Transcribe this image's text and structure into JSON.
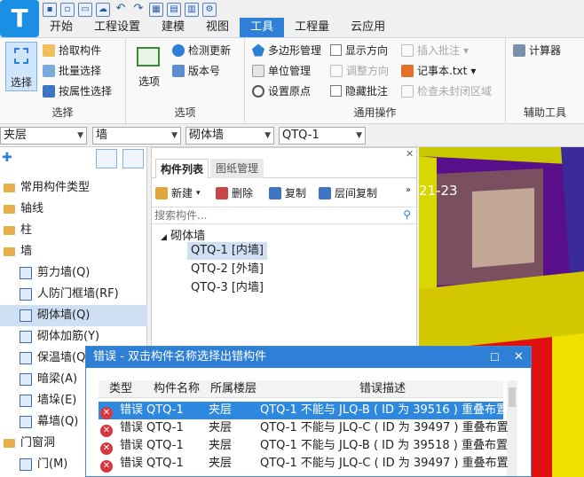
{
  "app": {
    "logo_letter": "T"
  },
  "menu": [
    "开始",
    "工程设置",
    "建模",
    "视图",
    "工具",
    "工程量",
    "云应用"
  ],
  "menu_active": "工具",
  "ribbon": {
    "select_group": {
      "select_button": "选择",
      "pick": "拾取构件",
      "batch": "批量选择",
      "by_attr": "按属性选择",
      "label": "选择"
    },
    "options_group": {
      "options_button": "选项",
      "check_update": "检测更新",
      "version": "版本号",
      "label": "选项"
    },
    "common_group": {
      "polygon": "多边形管理",
      "unit": "单位管理",
      "origin": "设置原点",
      "show_dir": "显示方向",
      "adjust_dir": "调整方向",
      "hide_note": "隐藏批注",
      "insert_note": "插入批注",
      "notepad": "记事本.txt",
      "check_open": "检查未封闭区域",
      "label": "通用操作"
    },
    "aux_group": {
      "calc": "计算器",
      "label": "辅助工具"
    }
  },
  "filters": {
    "floor": "夹层",
    "type": "墙",
    "subtype": "砌体墙",
    "component": "QTQ-1"
  },
  "tree": [
    {
      "label": "常用构件类型",
      "kind": "folder"
    },
    {
      "label": "轴线",
      "kind": "folder"
    },
    {
      "label": "柱",
      "kind": "folder"
    },
    {
      "label": "墙",
      "kind": "folder"
    },
    {
      "label": "剪力墙(Q)",
      "kind": "item"
    },
    {
      "label": "人防门框墙(RF)",
      "kind": "item"
    },
    {
      "label": "砌体墙(Q)",
      "kind": "item",
      "selected": true
    },
    {
      "label": "砌体加筋(Y)",
      "kind": "item"
    },
    {
      "label": "保温墙(Q)",
      "kind": "item"
    },
    {
      "label": "暗梁(A)",
      "kind": "item"
    },
    {
      "label": "墙垛(E)",
      "kind": "item"
    },
    {
      "label": "幕墙(Q)",
      "kind": "item"
    },
    {
      "label": "门窗洞",
      "kind": "folder"
    },
    {
      "label": "门(M)",
      "kind": "item"
    }
  ],
  "comp_panel": {
    "tabs": [
      "构件列表",
      "图纸管理"
    ],
    "toolbar": {
      "new": "新建",
      "delete": "删除",
      "copy": "复制",
      "floor_copy": "层间复制"
    },
    "search_placeholder": "搜索构件...",
    "group": "砌体墙",
    "items": [
      "QTQ-1 [内墙]",
      "QTQ-2 [外墙]",
      "QTQ-3 [内墙]"
    ]
  },
  "viewport": {
    "label": "21-23"
  },
  "error_dialog": {
    "title": "错误 - 双击构件名称选择出错构件",
    "columns": [
      "类型",
      "构件名称",
      "所属楼层",
      "错误描述"
    ],
    "rows": [
      {
        "type": "错误",
        "name": "QTQ-1",
        "floor": "夹层",
        "desc": "QTQ-1 不能与 JLQ-B ( ID 为 39516 ) 重叠布置"
      },
      {
        "type": "错误",
        "name": "QTQ-1",
        "floor": "夹层",
        "desc": "QTQ-1 不能与 JLQ-C ( ID 为 39497 ) 重叠布置"
      },
      {
        "type": "错误",
        "name": "QTQ-1",
        "floor": "夹层",
        "desc": "QTQ-1 不能与 JLQ-B ( ID 为 39518 ) 重叠布置"
      },
      {
        "type": "错误",
        "name": "QTQ-1",
        "floor": "夹层",
        "desc": "QTQ-1 不能与 JLQ-C ( ID 为 39497 ) 重叠布置"
      }
    ]
  }
}
